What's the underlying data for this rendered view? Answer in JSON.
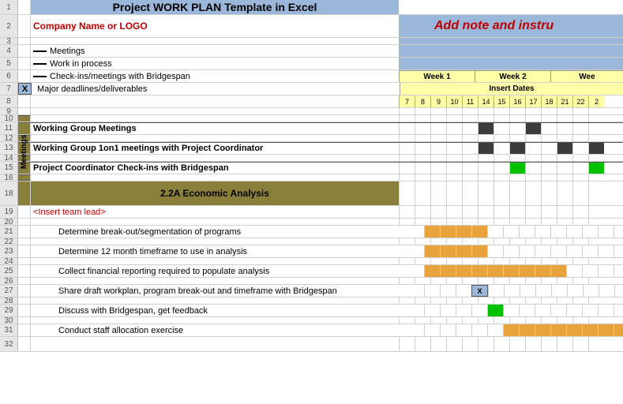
{
  "title": "Project  WORK PLAN Template in Excel",
  "company": "Company Name or LOGO",
  "note": "Add note and instru",
  "legend": {
    "meetings": "Meetings",
    "wip": "Work in process",
    "checkins": "Check-ins/meetings with Bridgespan",
    "deadlines": "Major deadlines/deliverables",
    "x": "X"
  },
  "weeks": {
    "w1": "Week 1",
    "w2": "Week 2",
    "w3": "Wee"
  },
  "insertDates": "Insert Dates",
  "days": [
    "7",
    "8",
    "9",
    "10",
    "11",
    "14",
    "15",
    "16",
    "17",
    "18",
    "21",
    "22",
    "2"
  ],
  "meetingsLabel": "Meetings",
  "mrow1": "Working Group Meetings",
  "mrow2": "Working Group 1on1 meetings with Project Coordinator",
  "mrow3": "Project Coordinator Check-ins with Bridgespan",
  "section": "2.2A Economic Analysis",
  "lead": "<Insert team lead>",
  "t1": "Determine break-out/segmentation of programs",
  "t2": "Determine 12 month timeframe to use in analysis",
  "t3": "Collect financial reporting required to populate analysis",
  "t4": "Share draft workplan, program break-out and timeframe with Bridgespan",
  "t5": "Discuss with Bridgespan, get feedback",
  "t6": "Conduct staff allocation exercise",
  "rows": [
    "1",
    "2",
    "3",
    "4",
    "5",
    "6",
    "7",
    "8",
    "9",
    "10",
    "11",
    "12",
    "13",
    "14",
    "15",
    "16",
    "18",
    "19",
    "20",
    "21",
    "22",
    "23",
    "24",
    "25",
    "26",
    "27",
    "28",
    "29",
    "30",
    "31",
    "32"
  ]
}
